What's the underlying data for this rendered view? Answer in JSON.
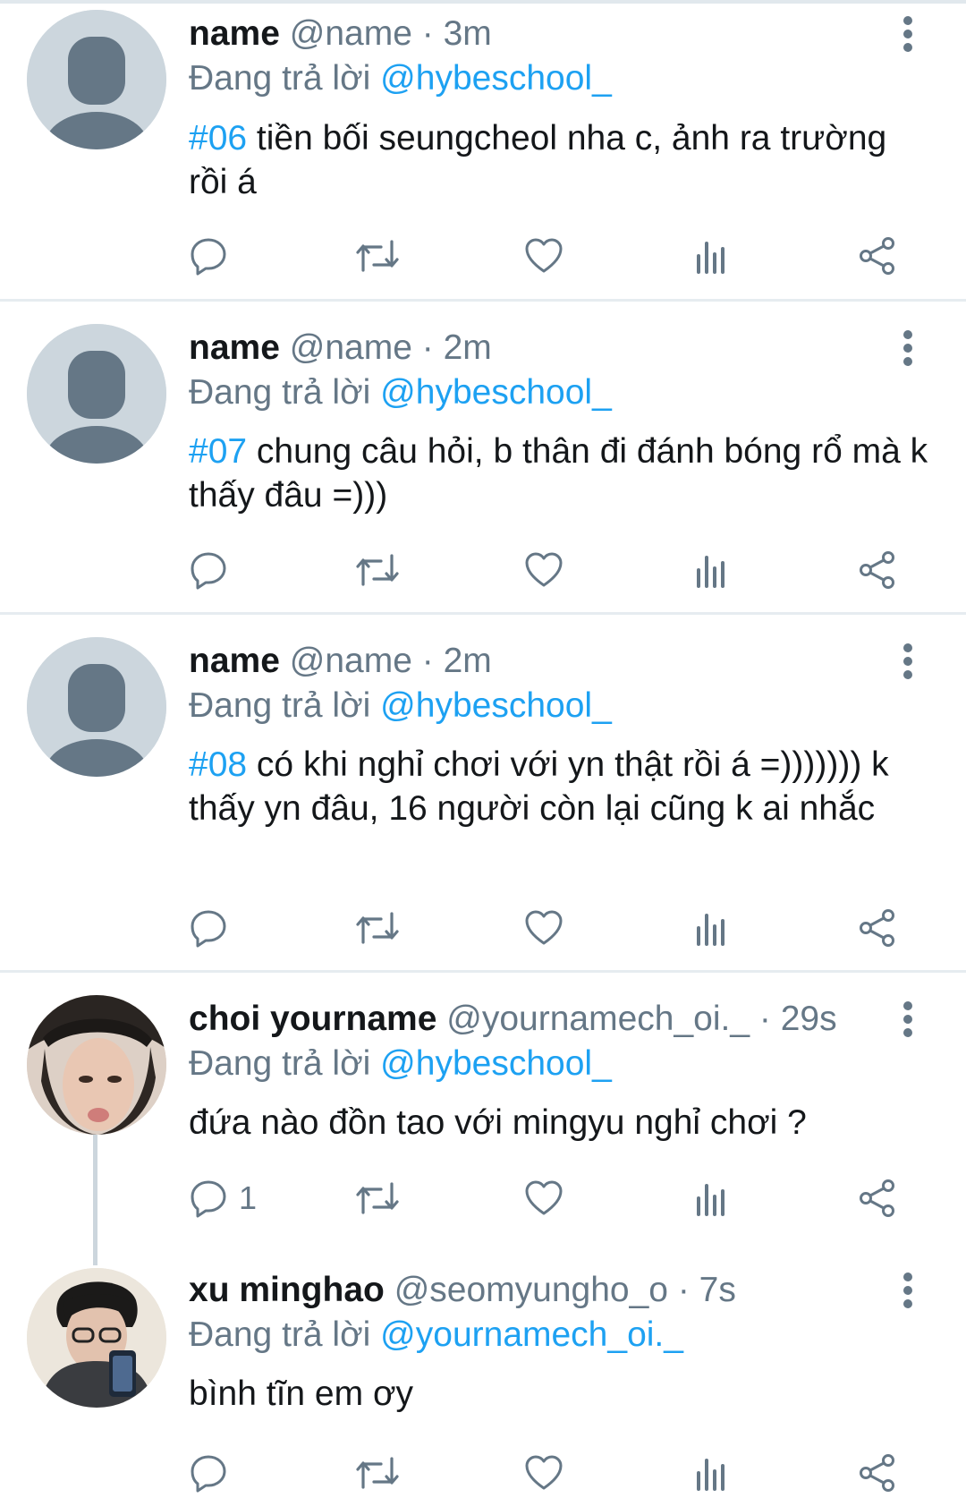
{
  "reply_prefix": "Đang trả lời",
  "tweets": [
    {
      "name": "name",
      "handle": "@name",
      "dot": "·",
      "time": "3m",
      "reply_to": "@hybeschool_",
      "tag": "#06",
      "text": " tiền bối seungcheol nha c, ảnh ra trường rồi á",
      "reply_count": ""
    },
    {
      "name": "name",
      "handle": "@name",
      "dot": "·",
      "time": "2m",
      "reply_to": "@hybeschool_",
      "tag": "#07",
      "text": " chung câu hỏi, b thân đi đánh bóng rổ mà k thấy đâu =)))",
      "reply_count": ""
    },
    {
      "name": "name",
      "handle": "@name",
      "dot": "·",
      "time": "2m",
      "reply_to": "@hybeschool_",
      "tag": "#08",
      "text": " có khi nghỉ chơi với yn thật rồi á =))))))) k thấy yn đâu, 16 người còn lại cũng k ai nhắc",
      "reply_count": ""
    },
    {
      "name": "choi yourname",
      "handle": "@yournamech_oi._",
      "dot": "·",
      "time": "29s",
      "reply_to": "@hybeschool_",
      "tag": "",
      "text": "đứa nào đồn tao với mingyu nghỉ chơi ?",
      "reply_count": "1"
    },
    {
      "name": "xu minghao",
      "handle": "@seomyungho_o",
      "dot": "·",
      "time": "7s",
      "reply_to": "@yournamech_oi._",
      "tag": "",
      "text": "bình tĩn em ơy",
      "reply_count": ""
    }
  ],
  "icons": {
    "reply": "reply-icon",
    "retweet": "retweet-icon",
    "like": "heart-icon",
    "stats": "stats-icon",
    "share": "share-icon",
    "more": "more-vertical-icon"
  },
  "colors": {
    "link": "#1da1f2",
    "muted": "#657786",
    "text": "#14171a",
    "avatar_bg": "#ccd6dd"
  }
}
